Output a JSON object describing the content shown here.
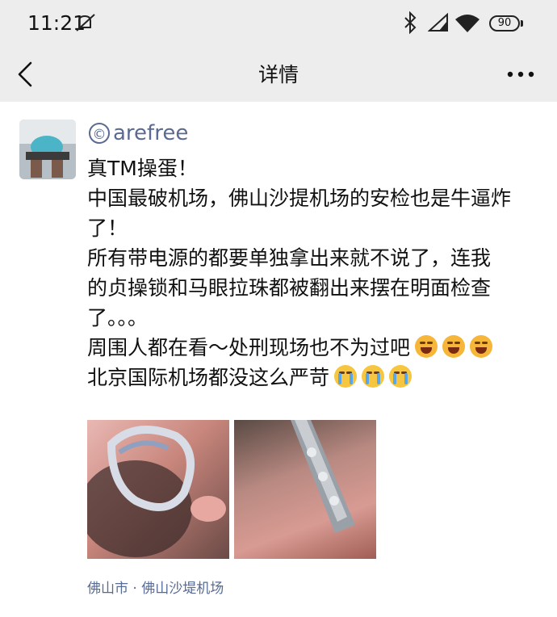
{
  "status_bar": {
    "time": "11:21",
    "battery": "90"
  },
  "nav": {
    "title": "详情"
  },
  "post": {
    "author": "arefree",
    "author_mark": "©",
    "lines": [
      "真TM操蛋！",
      "中国最破机场，佛山沙提机场的安检也是牛逼炸",
      "了！",
      "所有带电源的都要单独拿出来就不说了，连我",
      "的贞操锁和马眼拉珠都被翻出来摆在明面检查",
      "了。。。",
      "周围人都在看～处刑现场也不为过吧",
      "北京国际机场都没这么严苛"
    ],
    "emojis": {
      "line7": [
        "laughing-emoji",
        "laughing-emoji",
        "laughing-emoji"
      ],
      "line8": [
        "crying-emoji",
        "crying-emoji",
        "crying-emoji"
      ]
    },
    "location": "佛山市 · 佛山沙堤机场"
  }
}
